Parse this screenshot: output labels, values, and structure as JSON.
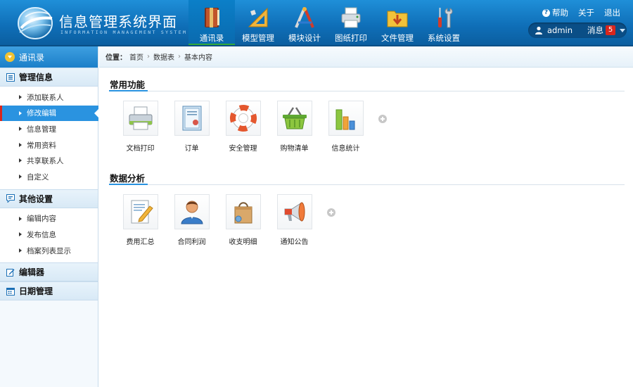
{
  "header": {
    "title": "信息管理系统界面",
    "subtitle": "INFORMATION MANAGEMENT SYSTEM GUI",
    "nav": [
      {
        "label": "通讯录",
        "icon": "address-book-icon",
        "active": true
      },
      {
        "label": "模型管理",
        "icon": "ruler-triangle-icon",
        "active": false
      },
      {
        "label": "模块设计",
        "icon": "drafting-tools-icon",
        "active": false
      },
      {
        "label": "图纸打印",
        "icon": "printer-icon",
        "active": false
      },
      {
        "label": "文件管理",
        "icon": "folder-download-icon",
        "active": false
      },
      {
        "label": "系统设置",
        "icon": "tools-icon",
        "active": false
      }
    ],
    "links": {
      "help": "帮助",
      "about": "关于",
      "logout": "退出"
    },
    "user": {
      "name": "admin",
      "message_label": "消息",
      "message_count": "5"
    }
  },
  "sidebar": {
    "top": "通讯录",
    "groups": [
      {
        "title": "管理信息",
        "icon": "list-icon",
        "items": [
          "添加联系人",
          "修改编辑",
          "信息管理",
          "常用资料",
          "共享联系人",
          "自定义"
        ]
      },
      {
        "title": "其他设置",
        "icon": "chat-icon",
        "items": [
          "编辑内容",
          "发布信息",
          "档案列表显示"
        ]
      },
      {
        "title": "编辑器",
        "icon": "edit-icon",
        "items": []
      },
      {
        "title": "日期管理",
        "icon": "calendar-icon",
        "items": []
      }
    ],
    "active_item": "修改编辑"
  },
  "breadcrumb": {
    "label": "位置：",
    "items": [
      "首页",
      "数据表",
      "基本内容"
    ]
  },
  "sections": [
    {
      "title": "常用功能",
      "tiles": [
        {
          "label": "文档打印",
          "icon": "printer-icon"
        },
        {
          "label": "订单",
          "icon": "certificate-icon"
        },
        {
          "label": "安全管理",
          "icon": "lifebuoy-icon"
        },
        {
          "label": "购物清单",
          "icon": "shopping-basket-icon"
        },
        {
          "label": "信息统计",
          "icon": "bar-chart-icon"
        }
      ]
    },
    {
      "title": "数据分析",
      "tiles": [
        {
          "label": "费用汇总",
          "icon": "document-pencil-icon"
        },
        {
          "label": "合同利润",
          "icon": "user-icon"
        },
        {
          "label": "收支明细",
          "icon": "shopping-bag-icon"
        },
        {
          "label": "通知公告",
          "icon": "megaphone-icon"
        }
      ]
    }
  ],
  "colors": {
    "header_blue": "#0f6fb8",
    "accent_blue": "#2a93e0",
    "active_underline": "#30a93b",
    "badge_red": "#d9261c"
  }
}
